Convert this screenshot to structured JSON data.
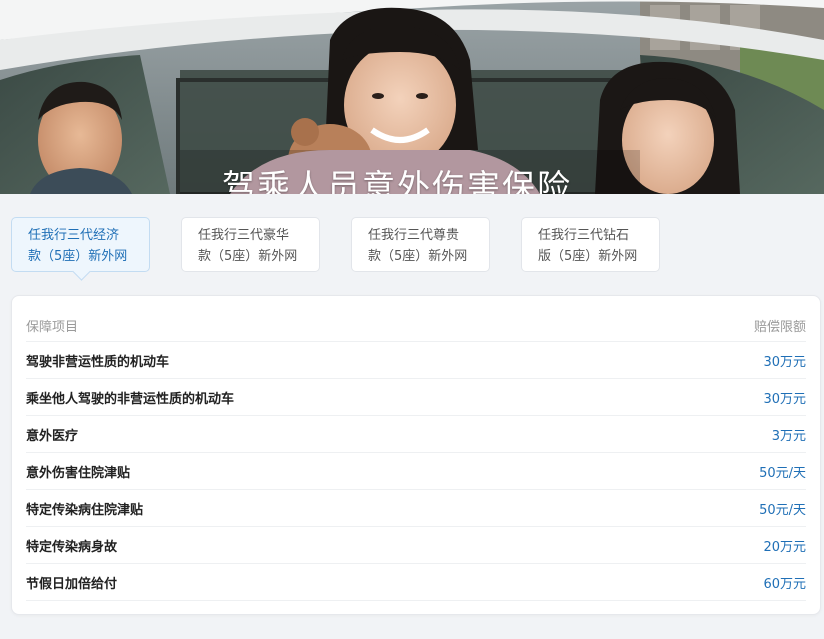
{
  "banner": {
    "title": "驾乘人员意外伤害保险"
  },
  "tabs": [
    {
      "line1": "任我行三代经济",
      "line2": "款（5座）新外网",
      "active": true
    },
    {
      "line1": "任我行三代豪华",
      "line2": "款（5座）新外网",
      "active": false
    },
    {
      "line1": "任我行三代尊贵",
      "line2": "款（5座）新外网",
      "active": false
    },
    {
      "line1": "任我行三代钻石",
      "line2": "版（5座）新外网",
      "active": false
    }
  ],
  "coverage": {
    "header_item": "保障项目",
    "header_amount": "赔偿限额",
    "rows": [
      {
        "item": "驾驶非营运性质的机动车",
        "amount": "30万元"
      },
      {
        "item": "乘坐他人驾驶的非营运性质的机动车",
        "amount": "30万元"
      },
      {
        "item": "意外医疗",
        "amount": "3万元"
      },
      {
        "item": "意外伤害住院津贴",
        "amount": "50元/天"
      },
      {
        "item": "特定传染病住院津贴",
        "amount": "50元/天"
      },
      {
        "item": "特定传染病身故",
        "amount": "20万元"
      },
      {
        "item": "节假日加倍给付",
        "amount": "60万元"
      }
    ]
  },
  "colors": {
    "accent": "#1f6fb6",
    "page_bg": "#f1f3f6",
    "active_tab_bg": "#eef6fd"
  }
}
